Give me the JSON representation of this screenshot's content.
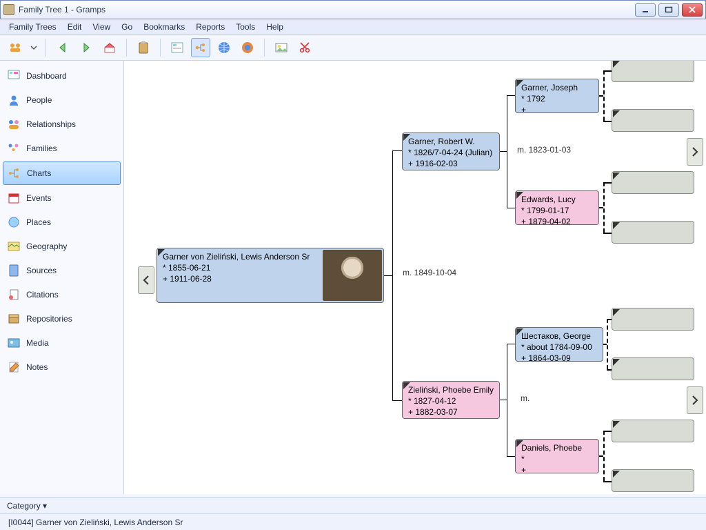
{
  "window": {
    "title": "Family Tree 1 - Gramps"
  },
  "menu": [
    "Family Trees",
    "Edit",
    "View",
    "Go",
    "Bookmarks",
    "Reports",
    "Tools",
    "Help"
  ],
  "toolbar": {
    "icons": [
      "people-link",
      "dropdown",
      "nav-back",
      "nav-forward",
      "home",
      "clipboard",
      "view-form",
      "view-pedigree",
      "globe-blue",
      "globe-orange",
      "photo",
      "scissors"
    ]
  },
  "sidebar": {
    "items": [
      {
        "icon": "dashboard",
        "label": "Dashboard"
      },
      {
        "icon": "person",
        "label": "People"
      },
      {
        "icon": "relationships",
        "label": "Relationships"
      },
      {
        "icon": "families",
        "label": "Families"
      },
      {
        "icon": "charts",
        "label": "Charts",
        "selected": true
      },
      {
        "icon": "events",
        "label": "Events"
      },
      {
        "icon": "places",
        "label": "Places"
      },
      {
        "icon": "geography",
        "label": "Geography"
      },
      {
        "icon": "sources",
        "label": "Sources"
      },
      {
        "icon": "citations",
        "label": "Citations"
      },
      {
        "icon": "repositories",
        "label": "Repositories"
      },
      {
        "icon": "media",
        "label": "Media"
      },
      {
        "icon": "notes",
        "label": "Notes"
      }
    ]
  },
  "category_button": "Category ▾",
  "status": "[I0044] Garner von Zieliński, Lewis Anderson Sr",
  "tree": {
    "root": {
      "name": "Garner von Zieliński, Lewis Anderson Sr",
      "birth": "* 1855-06-21",
      "death": "+ 1911-06-28",
      "sex": "male",
      "has_photo": true
    },
    "marriage_root": "m. 1849-10-04",
    "father": {
      "name": "Garner, Robert W.",
      "birth": "* 1826/7-04-24 (Julian)",
      "death": "+ 1916-02-03",
      "sex": "male"
    },
    "mother": {
      "name": "Zieliński, Phoebe Emily",
      "birth": "* 1827-04-12",
      "death": "+ 1882-03-07",
      "sex": "female"
    },
    "paternal_marriage": "m. 1823-01-03",
    "pgf": {
      "name": "Garner, Joseph",
      "birth": "* 1792",
      "death": "+",
      "sex": "male"
    },
    "pgm": {
      "name": "Edwards, Lucy",
      "birth": "* 1799-01-17",
      "death": "+ 1879-04-02",
      "sex": "female"
    },
    "maternal_marriage": "m.",
    "mgf": {
      "name": "Шестаков, George",
      "birth": "* about 1784-09-00",
      "death": "+ 1864-03-09",
      "sex": "male"
    },
    "mgm": {
      "name": "Daniels, Phoebe",
      "birth": "*",
      "death": "+",
      "sex": "female"
    }
  }
}
